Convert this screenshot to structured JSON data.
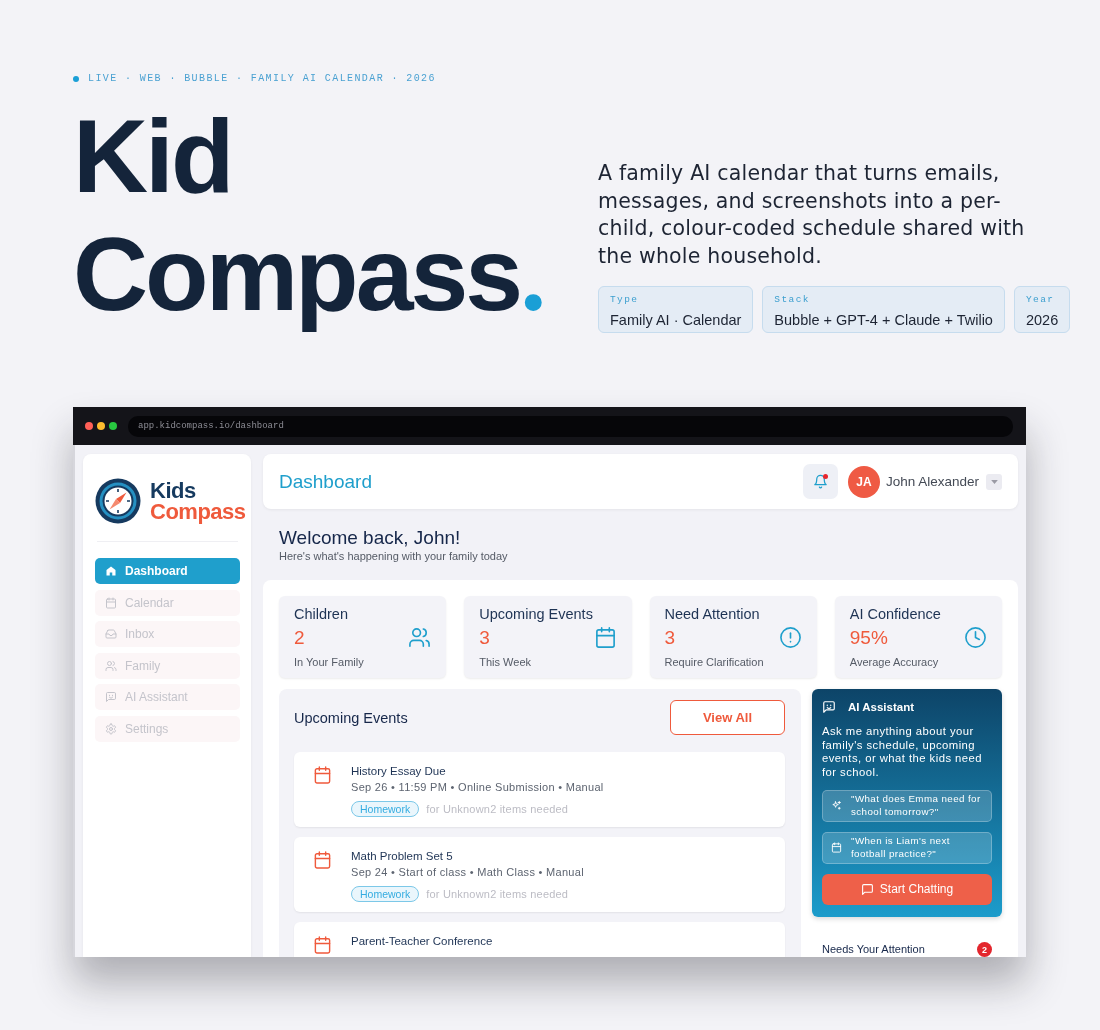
{
  "tagline": {
    "live": true,
    "text": "LIVE · WEB · BUBBLE · FAMILY AI CALENDAR · 2026"
  },
  "hero": {
    "title_lines": [
      "Kid",
      "Compass"
    ],
    "title_accent": ".",
    "description": "A family AI calendar that turns emails, messages, and screenshots into a per-child, colour-coded schedule shared with the whole household.",
    "facts": [
      {
        "label": "Type",
        "value": "Family AI · Calendar"
      },
      {
        "label": "Stack",
        "value": "Bubble + GPT-4 + Claude + Twilio"
      },
      {
        "label": "Year",
        "value": "2026"
      }
    ]
  },
  "browser": {
    "url": "app.kidcompass.io/dashboard"
  },
  "sidebar": {
    "logo_lines": [
      "Kids",
      "Compass"
    ],
    "items": [
      {
        "label": "Dashboard",
        "selected": true
      },
      {
        "label": "Calendar",
        "selected": false
      },
      {
        "label": "Inbox",
        "selected": false
      },
      {
        "label": "Family",
        "selected": false
      },
      {
        "label": "AI Assistant",
        "selected": false
      },
      {
        "label": "Settings",
        "selected": false
      }
    ]
  },
  "header": {
    "title": "Dashboard",
    "bell_unread": true,
    "user": {
      "initials": "JA",
      "name": "John Alexander"
    }
  },
  "welcome": {
    "title": "Welcome back, John!",
    "subtitle": "Here's what's happening with your family today"
  },
  "stats": [
    {
      "label": "Children",
      "value": "2",
      "caption": "In Your Family"
    },
    {
      "label": "Upcoming Events",
      "value": "3",
      "caption": "This Week"
    },
    {
      "label": "Need Attention",
      "value": "3",
      "caption": "Require Clarification"
    },
    {
      "label": "AI Confidence",
      "value": "95%",
      "caption": "Average Accuracy"
    }
  ],
  "events": {
    "title": "Upcoming Events",
    "action": "View All",
    "items": [
      {
        "title": "History Essay Due",
        "meta": "Sep 26 • 11:59 PM • Online Submission • Manual",
        "tag": "Homework",
        "note": "for Unknown2 items needed"
      },
      {
        "title": "Math Problem Set 5",
        "meta": "Sep 24 • Start of class • Math Class • Manual",
        "tag": "Homework",
        "note": "for Unknown2 items needed"
      },
      {
        "title": "Parent-Teacher Conference"
      }
    ]
  },
  "assistant": {
    "title": "AI Assistant",
    "description": "Ask me anything about your family's schedule, upcoming events, or what the kids need for school.",
    "suggestions": [
      "\"What does Emma need for school tomorrow?\"",
      "\"When is Liam's next football practice?\""
    ],
    "action": "Start Chatting"
  },
  "attention": {
    "title": "Needs Your Attention",
    "count": "2"
  }
}
